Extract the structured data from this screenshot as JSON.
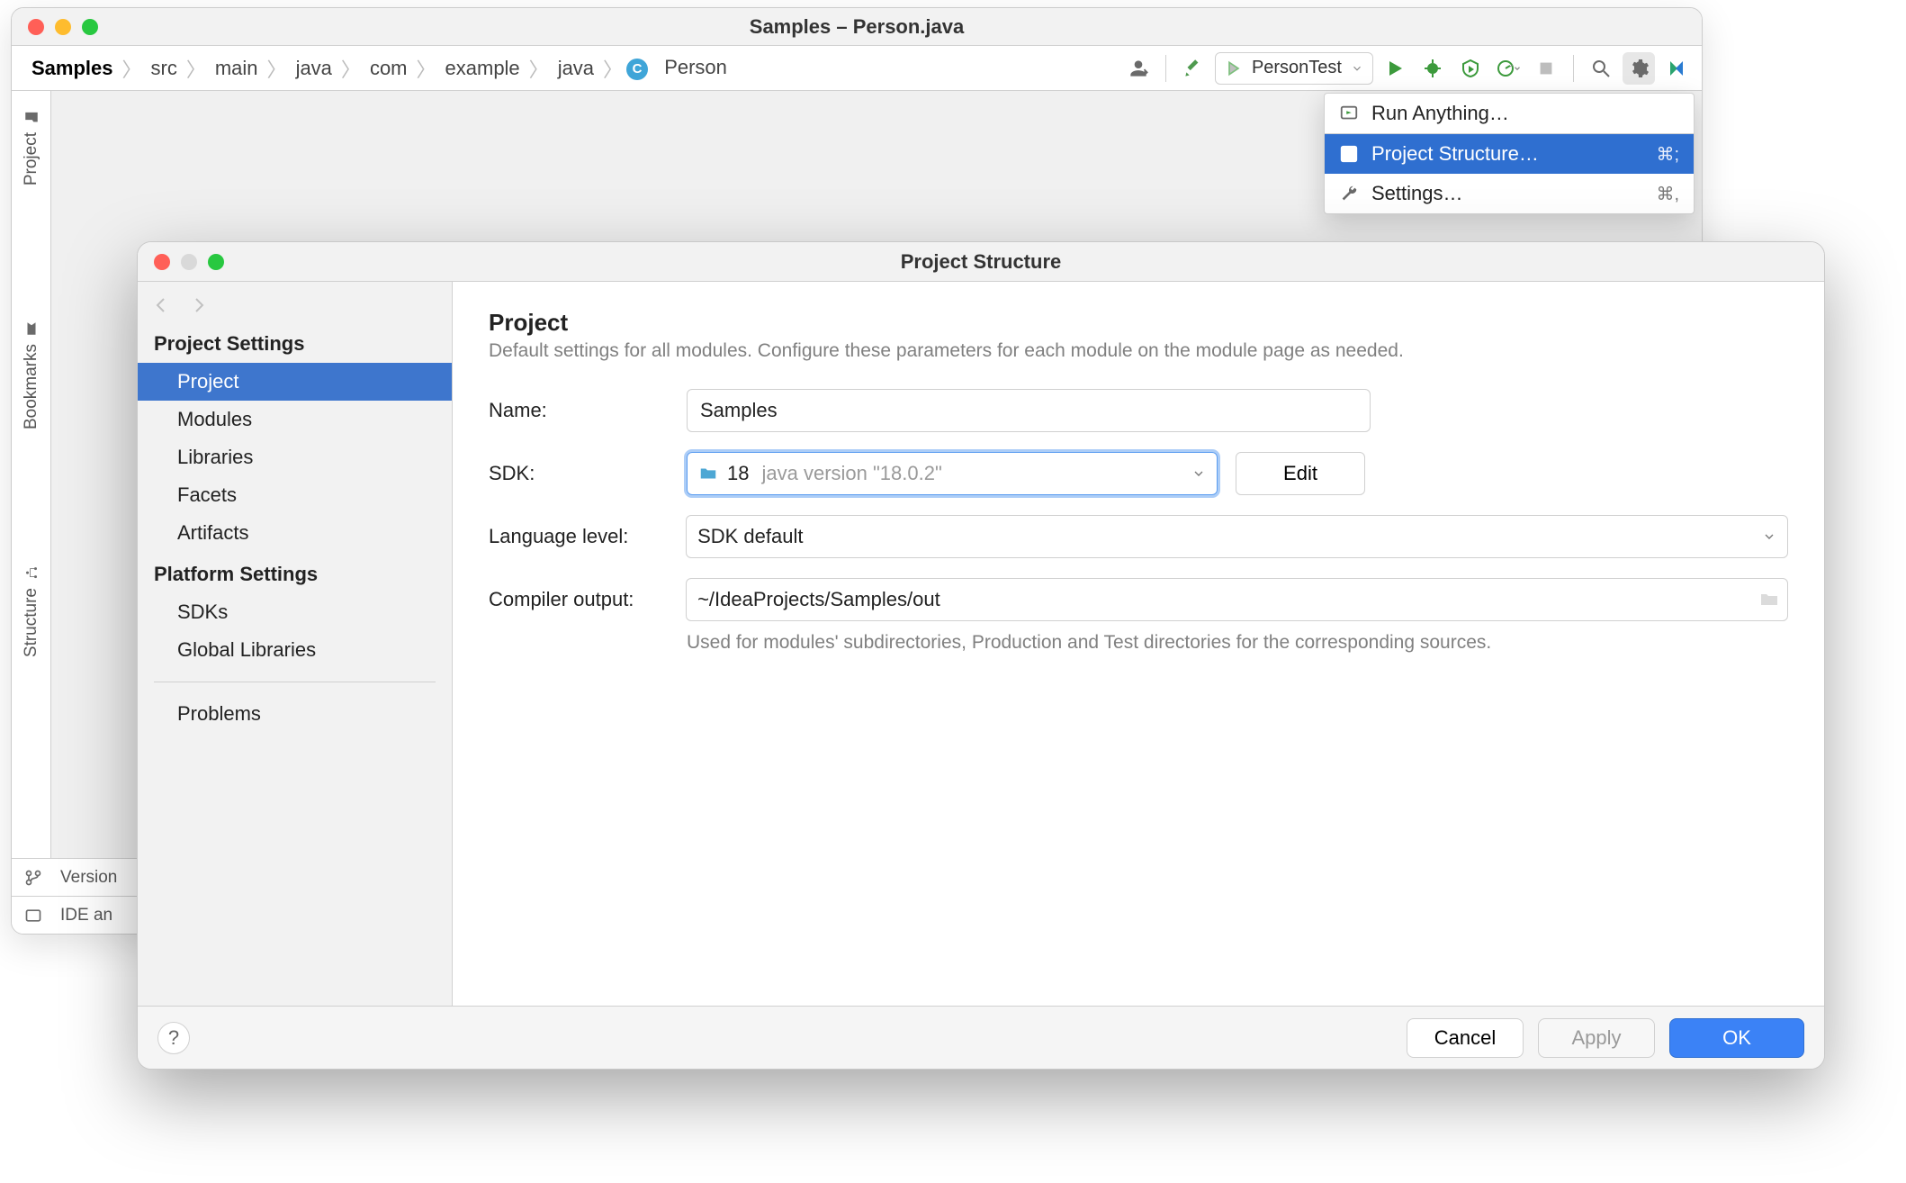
{
  "window": {
    "title": "Samples – Person.java"
  },
  "breadcrumbs": {
    "items": [
      "Samples",
      "src",
      "main",
      "java",
      "com",
      "example",
      "java",
      "Person"
    ],
    "file_kind": "C"
  },
  "toolbar": {
    "run_config": "PersonTest"
  },
  "popup": {
    "run_anything": "Run Anything…",
    "project_structure": "Project Structure…",
    "project_structure_sc": "⌘;",
    "settings": "Settings…",
    "settings_sc": "⌘,"
  },
  "left_rail": {
    "project": "Project",
    "bookmarks": "Bookmarks",
    "structure": "Structure"
  },
  "statusbar": {
    "line1": "Version",
    "line2": "IDE an"
  },
  "dialog": {
    "title": "Project Structure",
    "sections": {
      "project_settings_h": "Project Settings",
      "project": "Project",
      "modules": "Modules",
      "libraries": "Libraries",
      "facets": "Facets",
      "artifacts": "Artifacts",
      "platform_settings_h": "Platform Settings",
      "sdks": "SDKs",
      "global_libraries": "Global Libraries",
      "problems": "Problems"
    },
    "form": {
      "heading": "Project",
      "desc": "Default settings for all modules. Configure these parameters for each module on the module page as needed.",
      "name_label": "Name:",
      "name_value": "Samples",
      "sdk_label": "SDK:",
      "sdk_value": "18",
      "sdk_version_detail": "java version \"18.0.2\"",
      "edit_btn": "Edit",
      "language_level_label": "Language level:",
      "language_level_value": "SDK default",
      "compiler_output_label": "Compiler output:",
      "compiler_output_value": "~/IdeaProjects/Samples/out",
      "compiler_output_helper": "Used for modules' subdirectories, Production and Test directories for the corresponding sources."
    },
    "footer": {
      "help": "?",
      "cancel": "Cancel",
      "apply": "Apply",
      "ok": "OK"
    }
  }
}
